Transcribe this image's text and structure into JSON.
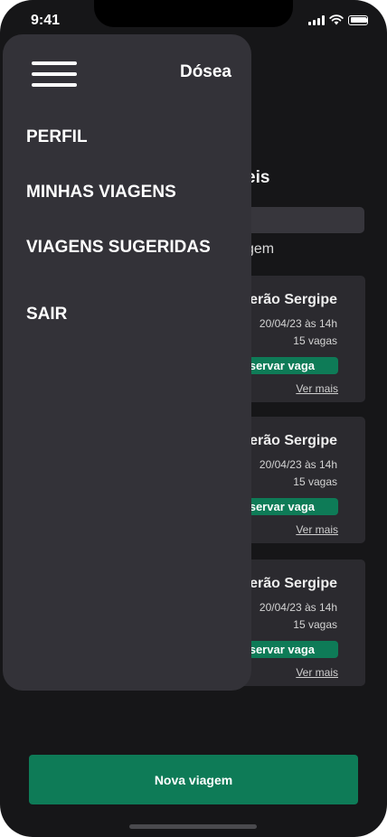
{
  "status_bar": {
    "time": "9:41"
  },
  "background": {
    "section_title_partial": "eis",
    "subline_partial": "gem",
    "cards": [
      {
        "title": "Verão Sergipe",
        "date": "20/04/23 às 14h",
        "seats": "15 vagas",
        "reserve": "eservar vaga",
        "more": "Ver mais"
      },
      {
        "title": "Verão Sergipe",
        "date": "20/04/23 às 14h",
        "seats": "15 vagas",
        "reserve": "eservar vaga",
        "more": "Ver mais"
      },
      {
        "title": "Verão Sergipe",
        "date": "20/04/23 às 14h",
        "seats": "15 vagas",
        "reserve": "eservar vaga",
        "more": "Ver mais"
      }
    ],
    "new_trip_button": "Nova viagem"
  },
  "drawer": {
    "brand": "Dósea",
    "items": [
      {
        "label": "PERFIL"
      },
      {
        "label": "MINHAS VIAGENS"
      },
      {
        "label": "VIAGENS SUGERIDAS"
      },
      {
        "label": "SAIR"
      }
    ]
  },
  "colors": {
    "background": "#161618",
    "drawer": "#333238",
    "accent_green": "#0e7b57",
    "card": "#2b2a2f"
  },
  "icons": [
    "menu-icon",
    "signal-icon",
    "wifi-icon",
    "battery-icon"
  ]
}
